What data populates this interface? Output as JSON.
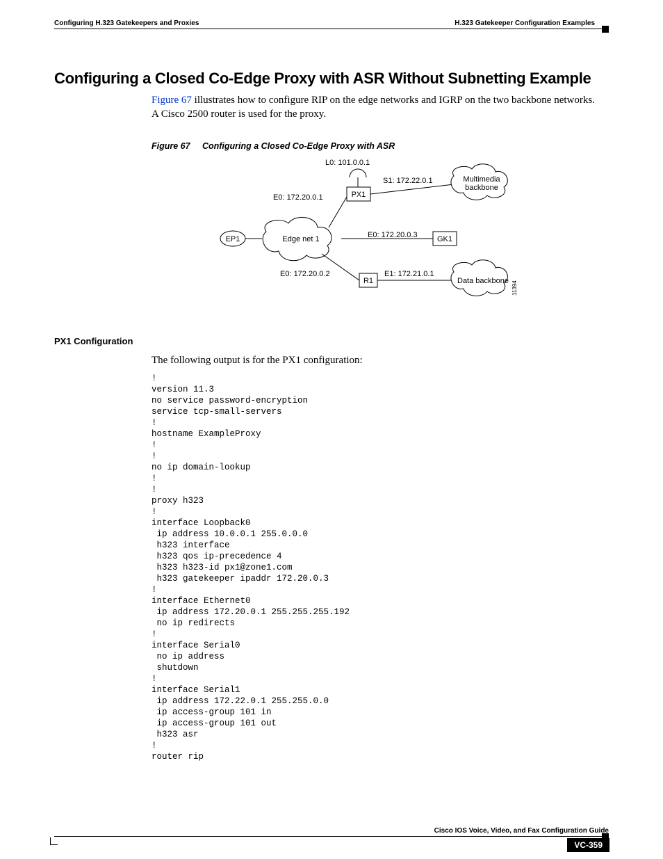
{
  "header": {
    "left": "Configuring H.323 Gatekeepers and Proxies",
    "right": "H.323 Gatekeeper Configuration Examples"
  },
  "section_title": "Configuring a Closed Co-Edge Proxy with ASR Without Subnetting Example",
  "intro": {
    "figref": "Figure 67",
    "rest": " illustrates how to configure RIP on the edge networks and IGRP on the two backbone networks. A Cisco 2500 router is used for the proxy."
  },
  "figure": {
    "number": "Figure 67",
    "title": "Configuring a Closed Co-Edge Proxy with ASR",
    "labels": {
      "L0": "L0:  101.0.0.1",
      "S1": "S1:  172.22.0.1",
      "E0_px": "E0:  172.20.0.1",
      "E0_gk": "E0:  172.20.0.3",
      "E0_r1": "E0:  172.20.0.2",
      "E1_r1": "E1:  172.21.0.1",
      "PX1": "PX1",
      "GK1": "GK1",
      "R1": "R1",
      "EP1": "EP1",
      "edge": "Edge net 1",
      "mm": "Multimedia backbone",
      "data": "Data backbone",
      "imgno": "11394"
    }
  },
  "px1_heading": "PX1 Configuration",
  "px1_intro": "The following output is for the PX1 configuration:",
  "config": "!\nversion 11.3\nno service password-encryption\nservice tcp-small-servers\n!\nhostname ExampleProxy\n!\n!\nno ip domain-lookup\n!\n!\nproxy h323\n!\ninterface Loopback0\n ip address 10.0.0.1 255.0.0.0\n h323 interface\n h323 qos ip-precedence 4\n h323 h323-id px1@zone1.com\n h323 gatekeeper ipaddr 172.20.0.3\n!\ninterface Ethernet0\n ip address 172.20.0.1 255.255.255.192\n no ip redirects\n!\ninterface Serial0\n no ip address\n shutdown\n!\ninterface Serial1\n ip address 172.22.0.1 255.255.0.0\n ip access-group 101 in\n ip access-group 101 out\n h323 asr\n!\nrouter rip",
  "footer": {
    "title": "Cisco IOS Voice, Video, and Fax Configuration Guide",
    "page": "VC-359"
  }
}
